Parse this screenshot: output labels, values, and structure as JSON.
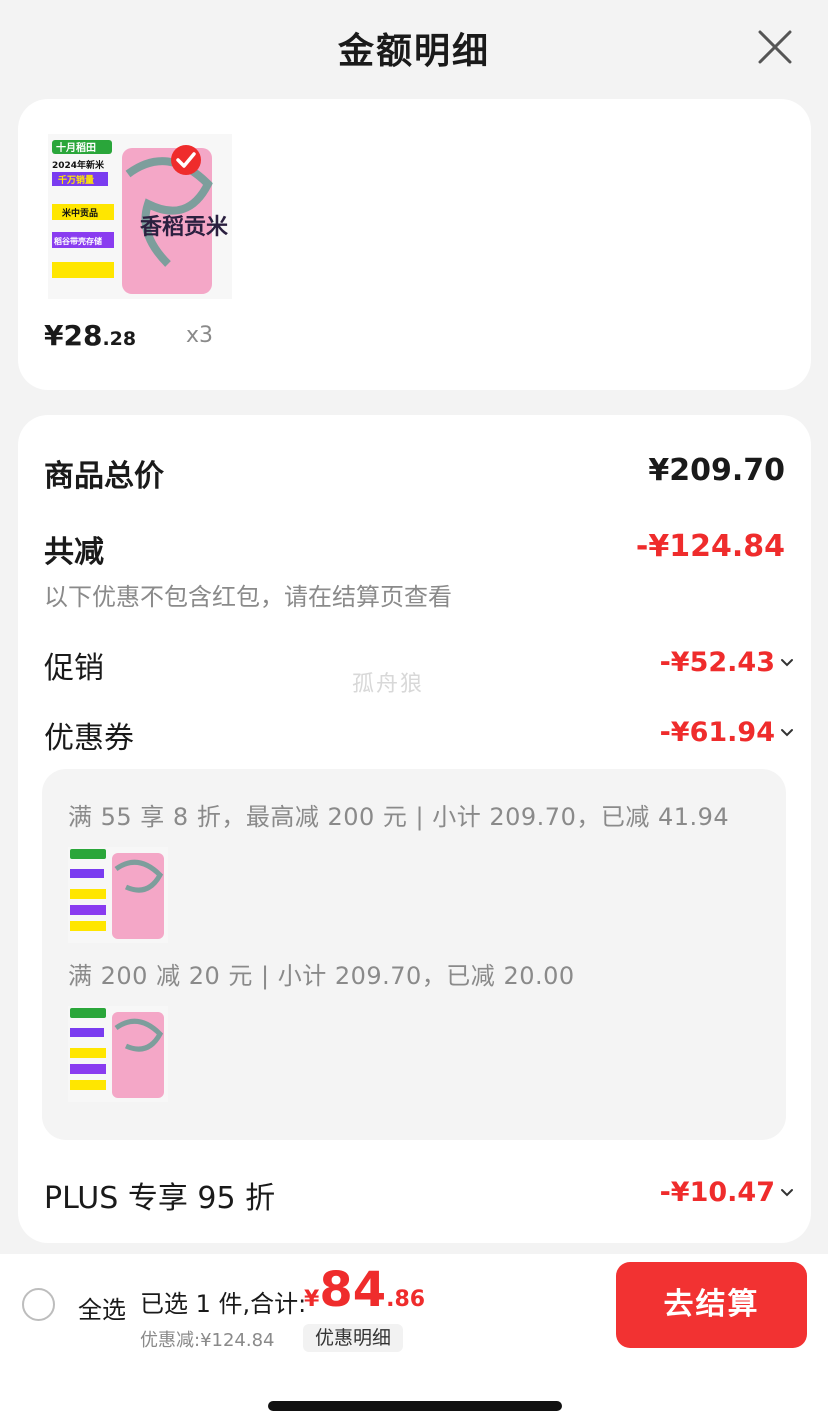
{
  "header": {
    "title": "金额明细"
  },
  "product": {
    "price_int": "¥28",
    "price_dec": ".28",
    "quantity": "x3",
    "thumb_texts": [
      "十月稻田",
      "2024年新米",
      "千万销量",
      "米中贡品",
      "稻谷带壳存储",
      "香稻贡米"
    ]
  },
  "summary": {
    "total_label": "商品总价",
    "total_value": "¥209.70",
    "reduce_label": "共减",
    "reduce_value": "-¥124.84",
    "note": "以下优惠不包含红包，请在结算页查看",
    "promo_label": "促销",
    "promo_value": "-¥52.43",
    "coupon_label": "优惠券",
    "coupon_value": "-¥61.94",
    "plus_label": "PLUS 专享 95 折",
    "plus_value": "-¥10.47"
  },
  "coupons": [
    {
      "text": "满 55 享 8 折，最高减 200 元 | 小计 209.70，已减 41.94"
    },
    {
      "text": "满 200 减 20 元 | 小计 209.70，已减 20.00"
    }
  ],
  "watermark": "孤舟狼",
  "footer": {
    "select_all": "全选",
    "selected_text": "已选 1 件,合计:",
    "currency": "¥",
    "total_int": "84",
    "total_dec": ".86",
    "discount_text": "优惠减:¥124.84",
    "detail_label": "优惠明细",
    "checkout_label": "去结算"
  },
  "colors": {
    "accent": "#ef2c2c",
    "checkout_bg": "#f23232",
    "card_bg": "#ffffff",
    "page_bg": "#f3f3f3"
  }
}
